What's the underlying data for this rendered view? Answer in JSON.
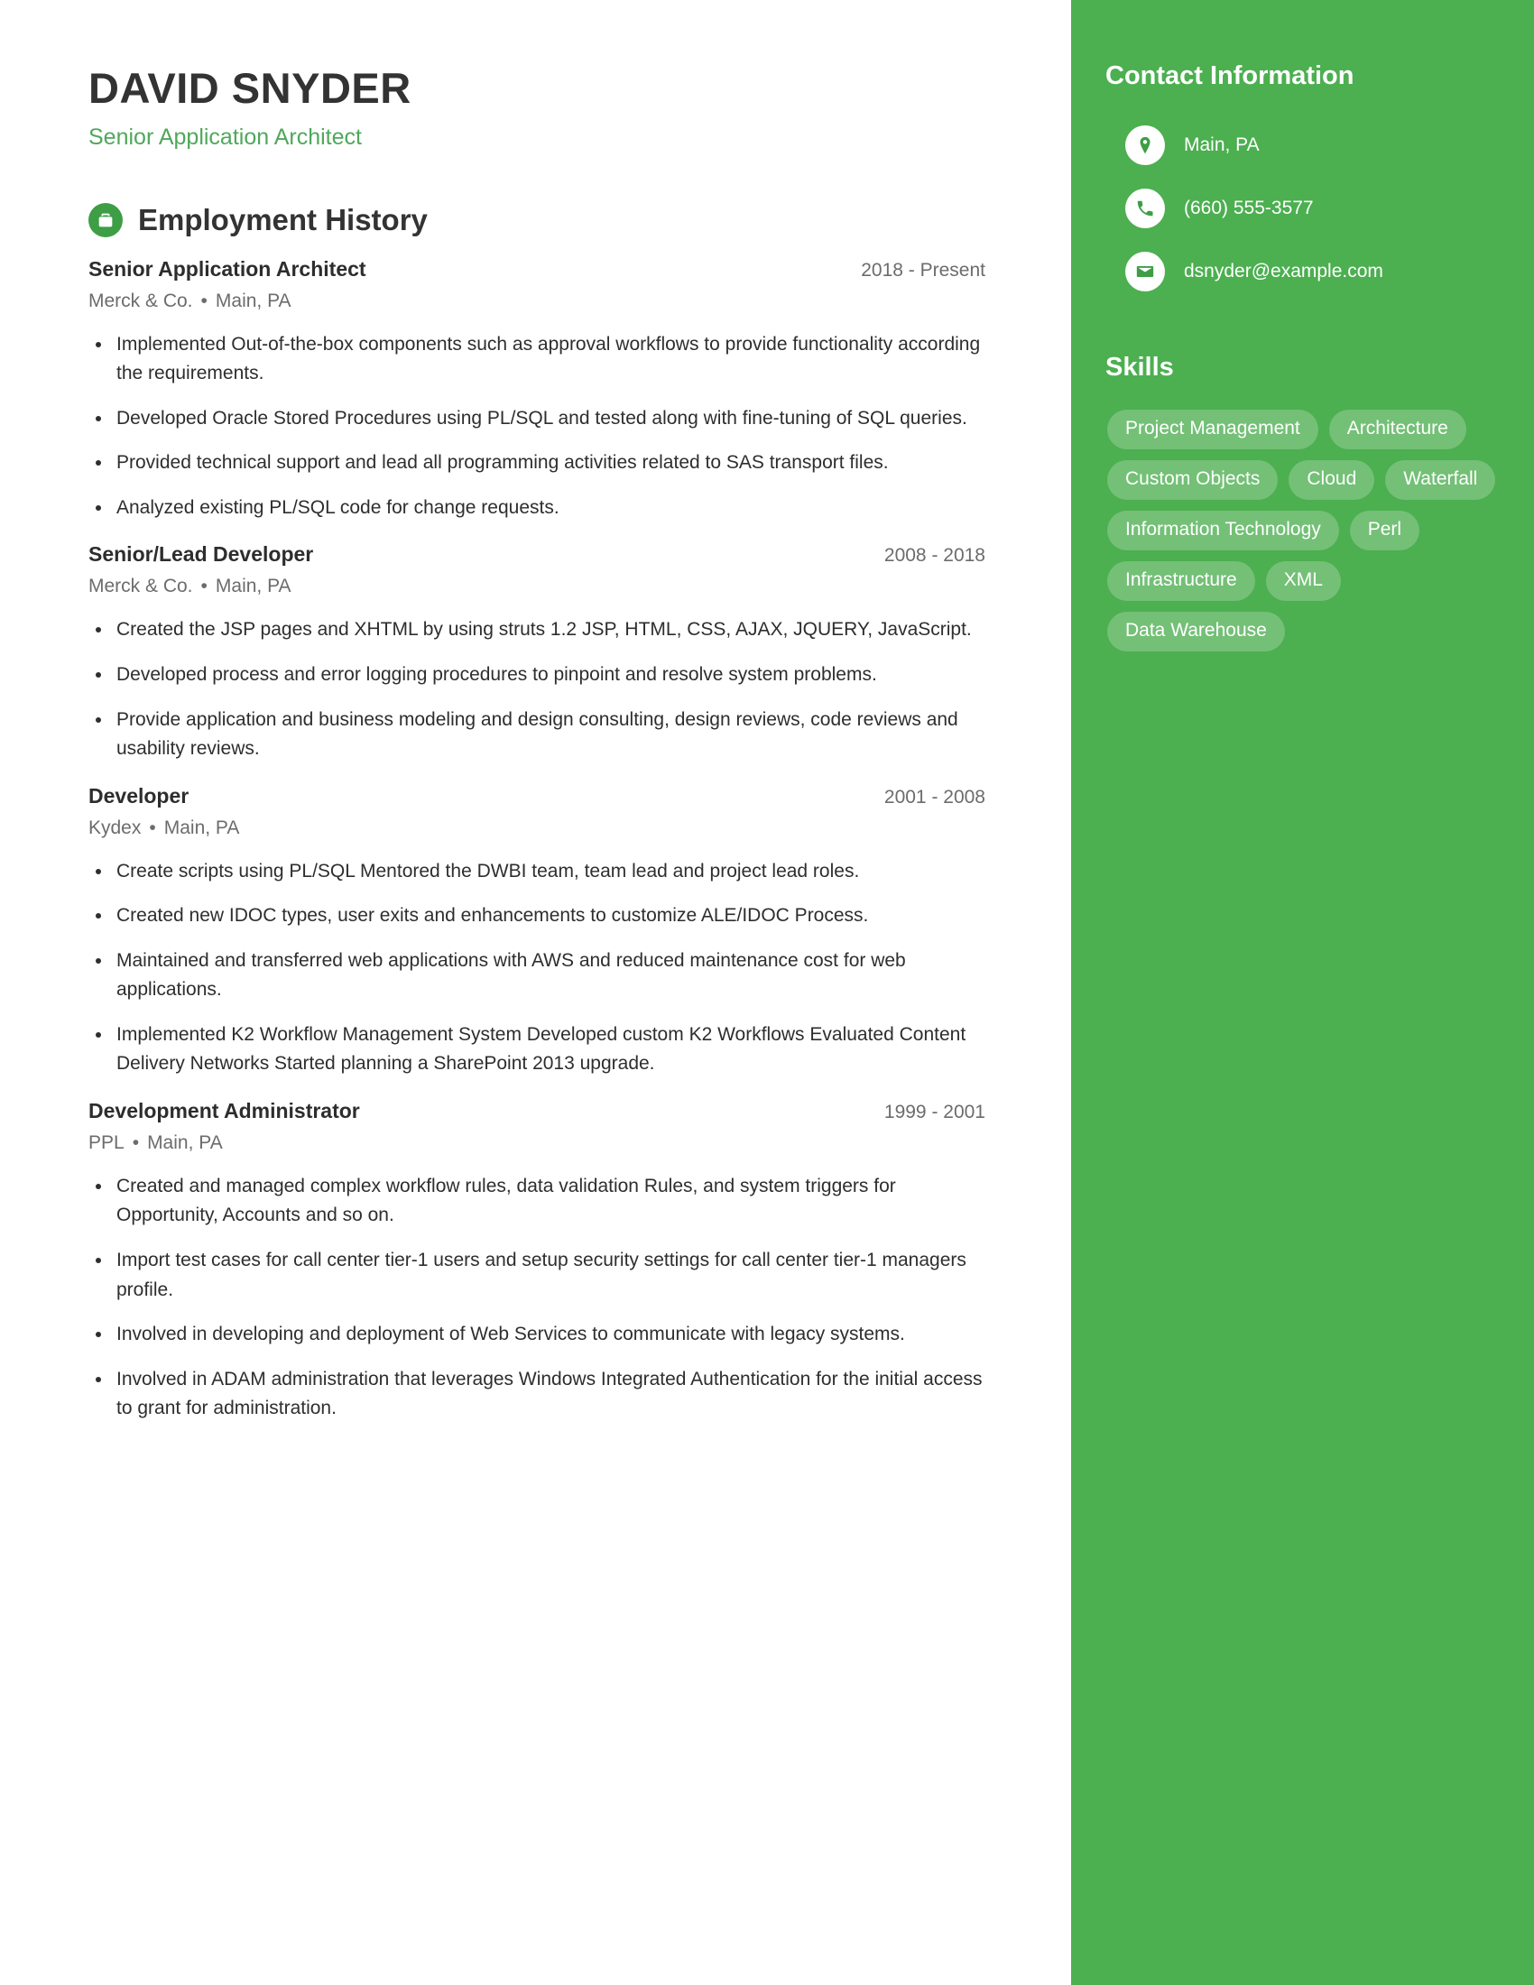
{
  "header": {
    "name": "DAVID SNYDER",
    "subtitle": "Senior Application Architect"
  },
  "colors": {
    "sidebar_green": "#4caf50",
    "accent_green": "#4fa85c",
    "icon_green": "#3d9e45",
    "heading_dark": "#333333",
    "body_text": "#2e2e2e",
    "muted_text": "#6c6c6c",
    "pill_bg": "rgba(255,255,255,0.22)"
  },
  "employment": {
    "section_title": "Employment History",
    "section_icon": "briefcase-icon",
    "separator": "•",
    "jobs": [
      {
        "title": "Senior Application Architect",
        "company": "Merck & Co.",
        "location": "Main, PA",
        "dates": "2018 - Present",
        "bullets": [
          "Implemented Out-of-the-box components such as approval workflows to provide functionality according the requirements.",
          "Developed Oracle Stored Procedures using PL/SQL and tested along with fine-tuning of SQL queries.",
          "Provided technical support and lead all programming activities related to SAS transport files.",
          "Analyzed existing PL/SQL code for change requests."
        ]
      },
      {
        "title": "Senior/Lead Developer",
        "company": "Merck & Co.",
        "location": "Main, PA",
        "dates": "2008 - 2018",
        "bullets": [
          "Created the JSP pages and XHTML by using struts 1.2 JSP, HTML, CSS, AJAX, JQUERY, JavaScript.",
          "Developed process and error logging procedures to pinpoint and resolve system problems.",
          "Provide application and business modeling and design consulting, design reviews, code reviews and usability reviews."
        ]
      },
      {
        "title": "Developer",
        "company": "Kydex",
        "location": "Main, PA",
        "dates": "2001 - 2008",
        "bullets": [
          "Create scripts using PL/SQL Mentored the DWBI team, team lead and project lead roles.",
          "Created new IDOC types, user exits and enhancements to customize ALE/IDOC Process.",
          "Maintained and transferred web applications with AWS and reduced maintenance cost for web applications.",
          "Implemented K2 Workflow Management System Developed custom K2 Workflows Evaluated Content Delivery Networks Started planning a SharePoint 2013 upgrade."
        ]
      },
      {
        "title": "Development Administrator",
        "company": "PPL",
        "location": "Main, PA",
        "dates": "1999 - 2001",
        "bullets": [
          "Created and managed complex workflow rules, data validation Rules, and system triggers for Opportunity, Accounts and so on.",
          "Import test cases for call center tier-1 users and setup security settings for call center tier-1 managers profile.",
          "Involved in developing and deployment of Web Services to communicate with legacy systems.",
          "Involved in ADAM administration that leverages Windows Integrated Authentication for the initial access to grant for administration."
        ]
      }
    ]
  },
  "sidebar": {
    "contact_title": "Contact Information",
    "contact_items": [
      {
        "icon": "location-pin-icon",
        "value": "Main, PA"
      },
      {
        "icon": "phone-icon",
        "value": "(660) 555-3577"
      },
      {
        "icon": "envelope-icon",
        "value": "dsnyder@example.com"
      }
    ],
    "skills_title": "Skills",
    "skills": [
      "Project Management",
      "Architecture",
      "Custom Objects",
      "Cloud",
      "Waterfall",
      "Information Technology",
      "Perl",
      "Infrastructure",
      "XML",
      "Data Warehouse"
    ]
  }
}
